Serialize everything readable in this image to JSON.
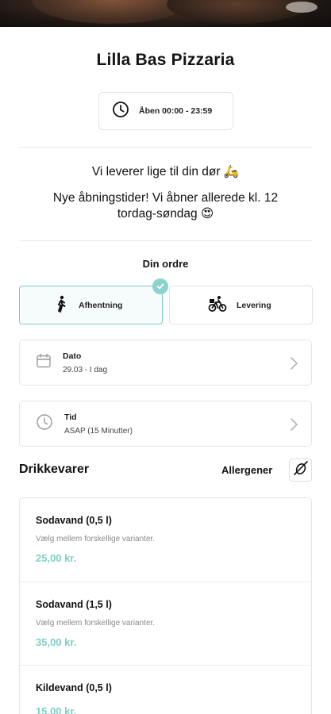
{
  "restaurant": {
    "name": "Lilla Bas Pizzaria"
  },
  "hours": {
    "text": "Åben 00:00 - 23:59"
  },
  "announcements": {
    "delivery": "Vi leverer lige til din dør 🛵",
    "hours_line1": "Nye åbningstider! Vi åbner allerede kl. 12",
    "hours_line2": "tordag-søndag 😍"
  },
  "order": {
    "section_label": "Din ordre",
    "modes": [
      {
        "label": "Afhentning",
        "icon": "walking-person-icon",
        "selected": true
      },
      {
        "label": "Levering",
        "icon": "bicycle-delivery-icon",
        "selected": false
      }
    ],
    "date": {
      "label": "Dato",
      "value": "29.03 - I dag"
    },
    "time": {
      "label": "Tid",
      "value": "ASAP (15 Minutter)"
    }
  },
  "menu": {
    "category": "Drikkevarer",
    "allergens_label": "Allergener",
    "items": [
      {
        "name": "Sodavand (0,5 l)",
        "description": "Vælg mellem forskellige varianter.",
        "price": "25,00 kr."
      },
      {
        "name": "Sodavand (1,5 l)",
        "description": "Vælg mellem forskellige varianter.",
        "price": "35,00 kr."
      },
      {
        "name": "Kildevand (0,5 l)",
        "description": "",
        "price": "15,00 kr."
      }
    ]
  },
  "colors": {
    "accent": "#7ecfc6",
    "selected_border": "#7ccbc7",
    "border": "#e4e4e4"
  }
}
